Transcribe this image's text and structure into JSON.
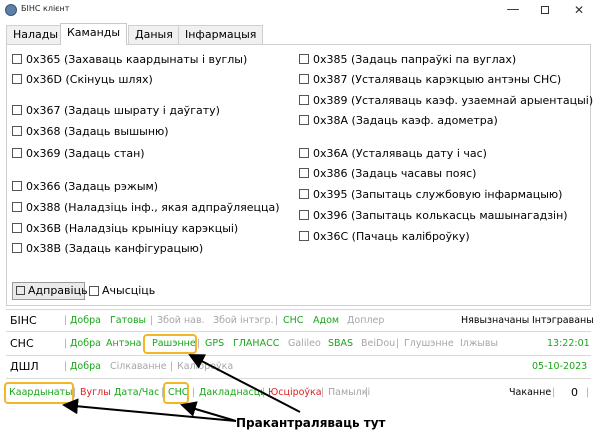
{
  "window": {
    "title": "БІНС клієнт",
    "min_glyph": "—",
    "close_glyph": "✕"
  },
  "tabs": [
    {
      "label": "Налады",
      "active": false
    },
    {
      "label": "Каманды",
      "active": true
    },
    {
      "label": "Даныя",
      "active": false
    },
    {
      "label": "Інфармацыя",
      "active": false
    }
  ],
  "commands_left": [
    "0x365 (Захаваць каардынаты і вуглы)",
    "0x36D (Скінуць шлях)",
    "0x367 (Задаць шырату і даўгату)",
    "0x368 (Задаць вышыню)",
    "0x369 (Задаць стан)",
    "0x366 (Задаць рэжым)",
    "0x388 (Наладзіць інф., якая адпраўляецца)",
    "0x36B (Наладзіць крыніцу карэкцыі)",
    "0x38B (Задаць канфігурацыю)"
  ],
  "commands_right": [
    "0x385 (Задаць папраўкі па вуглах)",
    "0x387 (Усталяваць карэкцыю антэны СНС)",
    "0x389 (Усталяваць каэф. узаемнай арыентацыі)",
    "0x38A (Задаць каэф. адометра)",
    "0x36A (Усталяваць дату і час)",
    "0x386 (Задаць часавы пояс)",
    "0x395 (Запытаць службовую інфармацыю)",
    "0x396 (Запытаць колькасць машынагадзін)",
    "0x36C (Пачаць каліброўку)"
  ],
  "send_button": "Адправіць",
  "clear_label": "Ачысціць",
  "bins_row": {
    "name": "БІНС",
    "items": [
      "Добра",
      "Гатовы",
      "Збой нав.",
      "Збой інтэгр.",
      "СНС",
      "Адом",
      "Доплер"
    ],
    "right_1": "Нявызначаны",
    "right_2": "Інтэграваны"
  },
  "sns_row": {
    "name": "СНС",
    "items": [
      "Добра",
      "Антэна",
      "Рашэнне",
      "GPS",
      "ГЛАНАСС",
      "Galileo",
      "SBAS",
      "BeiDou",
      "Глушэнне",
      "Ілжывы"
    ],
    "time": "13:22:01"
  },
  "dshl_row": {
    "name": "ДШЛ",
    "items": [
      "Добра",
      "Сілкаванне",
      "Каліброўка"
    ],
    "date": "05-10-2023"
  },
  "bottom_row": {
    "items": [
      "Каардынаты",
      "Вуглы",
      "Дата/Час",
      "СНС",
      "Дакладнасць",
      "Юсціроўка",
      "Памылкі"
    ],
    "wait_label": "Чаканне",
    "wait_value": "0"
  },
  "annotation": "Пракантраляваць тут",
  "colors": {
    "ok": "#1aa61a",
    "inactive": "#a6a6a6",
    "error": "#e02020",
    "highlight": "#f2b626"
  }
}
